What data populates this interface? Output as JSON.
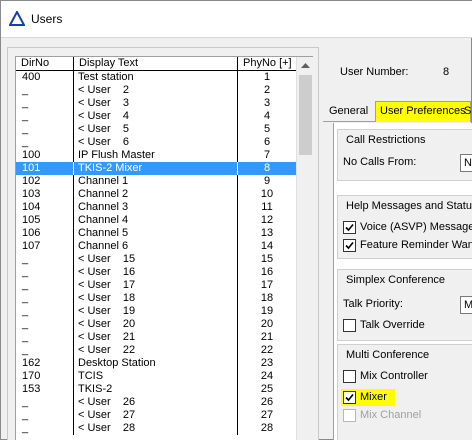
{
  "window": {
    "title": "Users",
    "icon": "triangle-app-icon"
  },
  "list": {
    "headers": {
      "dirno": "DirNo",
      "display": "Display Text",
      "phyno": "PhyNo [+]"
    },
    "rows": [
      {
        "dirno": "400",
        "display": "Test station",
        "phyno": "1"
      },
      {
        "dirno": "_",
        "display": "< User    2",
        "phyno": "2"
      },
      {
        "dirno": "_",
        "display": "< User    3",
        "phyno": "3"
      },
      {
        "dirno": "_",
        "display": "< User    4",
        "phyno": "4"
      },
      {
        "dirno": "_",
        "display": "< User    5",
        "phyno": "5"
      },
      {
        "dirno": "_",
        "display": "< User    6",
        "phyno": "6"
      },
      {
        "dirno": "100",
        "display": "IP Flush Master",
        "phyno": "7"
      },
      {
        "dirno": "101",
        "display": "TKIS-2 Mixer",
        "phyno": "8",
        "selected": true
      },
      {
        "dirno": "102",
        "display": "Channel 1",
        "phyno": "9"
      },
      {
        "dirno": "103",
        "display": "Channel 2",
        "phyno": "10"
      },
      {
        "dirno": "104",
        "display": "Channel 3",
        "phyno": "11"
      },
      {
        "dirno": "105",
        "display": "Channel 4",
        "phyno": "12"
      },
      {
        "dirno": "106",
        "display": "Channel 5",
        "phyno": "13"
      },
      {
        "dirno": "107",
        "display": "Channel 6",
        "phyno": "14"
      },
      {
        "dirno": "_",
        "display": "< User    15",
        "phyno": "15"
      },
      {
        "dirno": "_",
        "display": "< User    16",
        "phyno": "16"
      },
      {
        "dirno": "_",
        "display": "< User    17",
        "phyno": "17"
      },
      {
        "dirno": "_",
        "display": "< User    18",
        "phyno": "18"
      },
      {
        "dirno": "_",
        "display": "< User    19",
        "phyno": "19"
      },
      {
        "dirno": "_",
        "display": "< User    20",
        "phyno": "20"
      },
      {
        "dirno": "_",
        "display": "< User    21",
        "phyno": "21"
      },
      {
        "dirno": "_",
        "display": "< User    22",
        "phyno": "22"
      },
      {
        "dirno": "162",
        "display": "Desktop Station",
        "phyno": "23"
      },
      {
        "dirno": "170",
        "display": "TCIS",
        "phyno": "24"
      },
      {
        "dirno": "153",
        "display": "TKIS-2",
        "phyno": "25"
      },
      {
        "dirno": "_",
        "display": "< User    26",
        "phyno": "26"
      },
      {
        "dirno": "_",
        "display": "< User    27",
        "phyno": "27"
      },
      {
        "dirno": "_",
        "display": "< User    28",
        "phyno": "28"
      }
    ]
  },
  "details": {
    "user_number_label": "User Number:",
    "user_number_value": "8"
  },
  "tabs": {
    "general": "General",
    "user_preferences": "User Preferences",
    "more": "S"
  },
  "call_restrictions": {
    "title": "Call Restrictions",
    "no_calls_from_label": "No Calls From:",
    "no_calls_from_value": "N"
  },
  "help_messages": {
    "title": "Help Messages and Status",
    "voice_label": "Voice (ASVP) Message T",
    "voice_checked": true,
    "feature_reminder_label": "Feature Reminder Want",
    "feature_reminder_checked": true
  },
  "simplex_conference": {
    "title": "Simplex Conference",
    "talk_priority_label": "Talk Priority:",
    "talk_priority_value": "M",
    "talk_override_label": "Talk Override",
    "talk_override_checked": false
  },
  "multi_conference": {
    "title": "Multi Conference",
    "mix_controller_label": "Mix Controller",
    "mix_controller_checked": false,
    "mixer_label": "Mixer",
    "mixer_checked": true,
    "mix_channel_label": "Mix Channel",
    "mix_channel_checked": false
  },
  "colors": {
    "selection": "#3399ff",
    "highlight": "#ffff00",
    "window_bg": "#f0f0f0"
  }
}
